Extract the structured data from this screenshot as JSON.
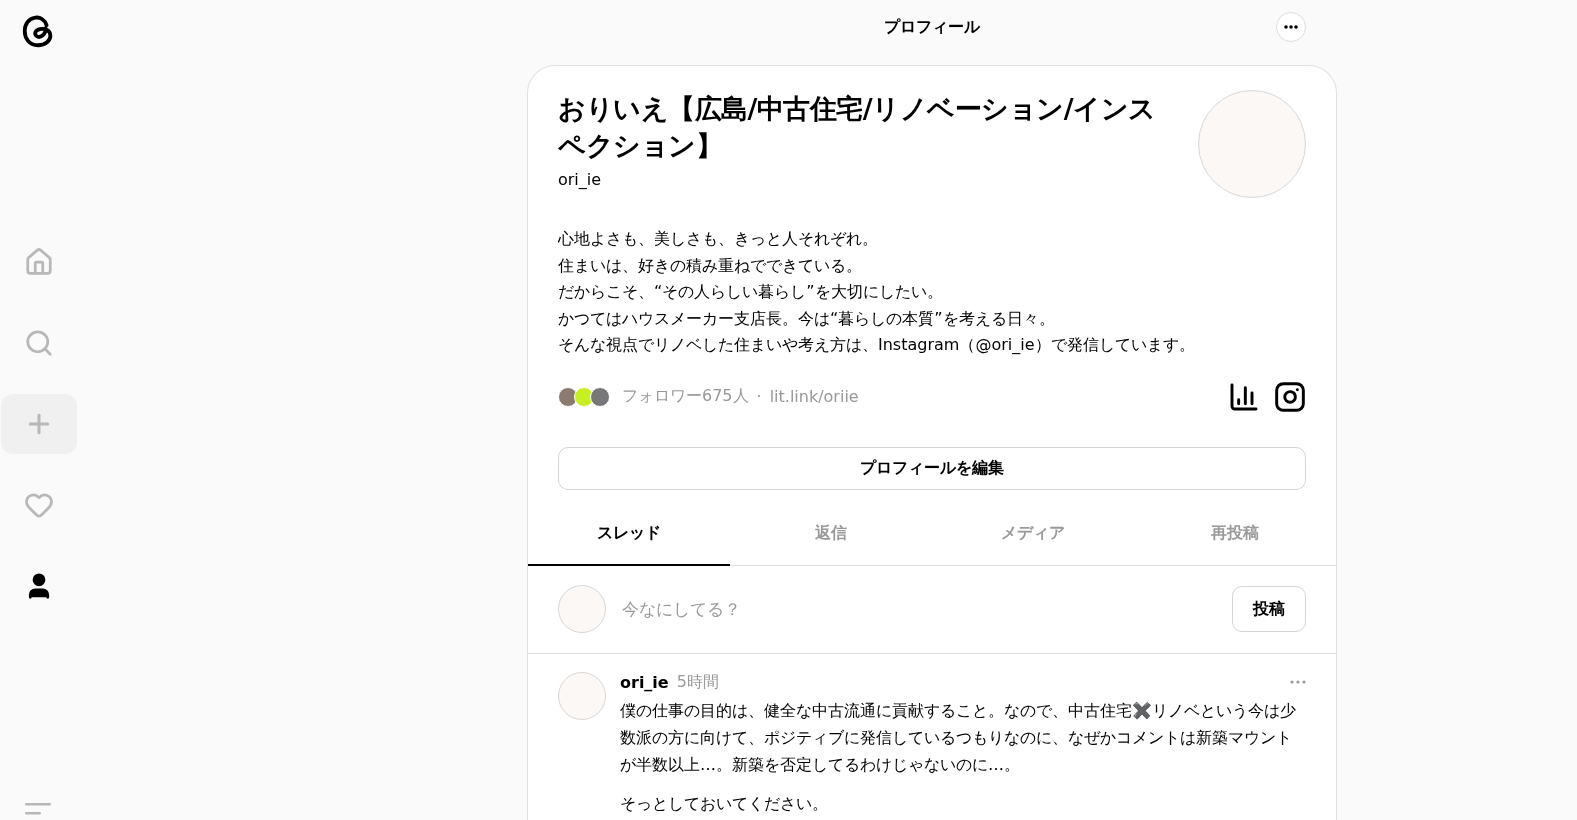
{
  "header": {
    "title": "プロフィール"
  },
  "nav": [
    {
      "kind": "home",
      "selected": false
    },
    {
      "kind": "search",
      "selected": false
    },
    {
      "kind": "create",
      "selected": false
    },
    {
      "kind": "activity",
      "selected": false
    },
    {
      "kind": "profile",
      "selected": true
    }
  ],
  "profile": {
    "name": "おりいえ【広島/中古住宅/リノベーション/インスペクション】",
    "handle": "ori_ie",
    "bio": [
      "心地よさも、美しさも、きっと人それぞれ。",
      "住まいは、好きの積み重ねでできている。",
      "だからこそ、“その人らしい暮らし”を大切にしたい。",
      "かつてはハウスメーカー支店長。今は“暮らしの本質”を考える日々。",
      "そんな視点でリノベした住まいや考え方は、Instagram（@ori_ie）で発信しています。"
    ],
    "followers": "フォロワー675人",
    "separator": "·",
    "link": "lit.link/oriie",
    "edit_button": "プロフィールを編集"
  },
  "tabs": [
    {
      "label": "スレッド",
      "selected": true
    },
    {
      "label": "返信",
      "selected": false
    },
    {
      "label": "メディア",
      "selected": false
    },
    {
      "label": "再投稿",
      "selected": false
    }
  ],
  "composer": {
    "placeholder": "今なにしてる？",
    "post_button": "投稿"
  },
  "posts": [
    {
      "author": "ori_ie",
      "time": "5時間",
      "paragraphs": [
        "僕の仕事の目的は、健全な中古流通に貢献すること。なので、中古住宅✖️リノベという今は少数派の方に向けて、ポジティブに発信しているつもりなのに、なぜかコメントは新築マウントが半数以上…。新築を否定してるわけじゃないのに…。",
        "そっとしておいてください。"
      ]
    }
  ]
}
